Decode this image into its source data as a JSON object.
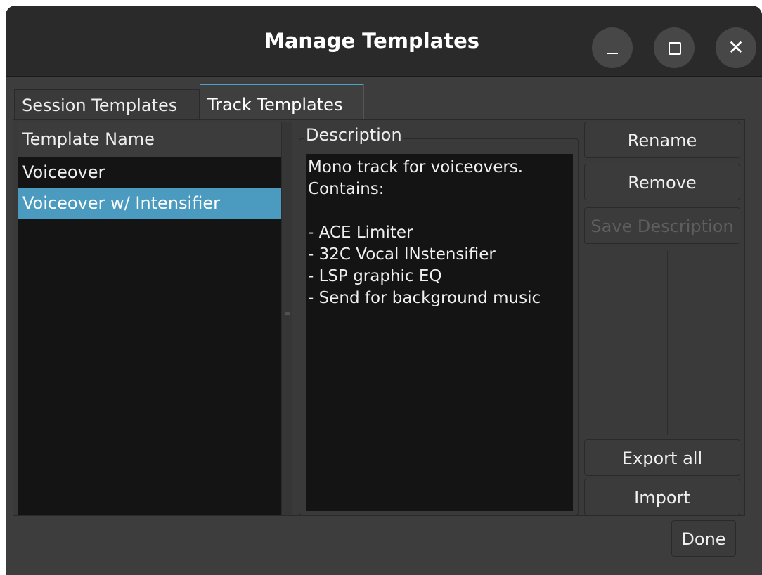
{
  "window": {
    "title": "Manage Templates",
    "controls": {
      "minimize_icon": "minimize-icon",
      "maximize_icon": "maximize-icon",
      "close_icon": "close-icon",
      "close_glyph": "✕"
    }
  },
  "tabs": [
    {
      "label": "Session Templates",
      "selected": false
    },
    {
      "label": "Track Templates",
      "selected": true
    }
  ],
  "template_list": {
    "header": "Template Name",
    "items": [
      {
        "label": "Voiceover",
        "selected": false
      },
      {
        "label": "Voiceover w/ Intensifier",
        "selected": true
      }
    ]
  },
  "description": {
    "label": "Description",
    "lines": [
      "Mono track for voiceovers.",
      "Contains:",
      "",
      "- ACE Limiter",
      "- 32C Vocal INstensifier",
      "- LSP graphic EQ",
      "- Send for background music"
    ]
  },
  "buttons": {
    "rename": "Rename",
    "remove": "Remove",
    "save_description": "Save Description",
    "export_all": "Export all",
    "import": "Import",
    "done": "Done"
  },
  "colors": {
    "selection": "#4a9bbf",
    "tab_accent": "#4ea2c6",
    "background": "#3a3a3a",
    "list_background": "#141414"
  }
}
